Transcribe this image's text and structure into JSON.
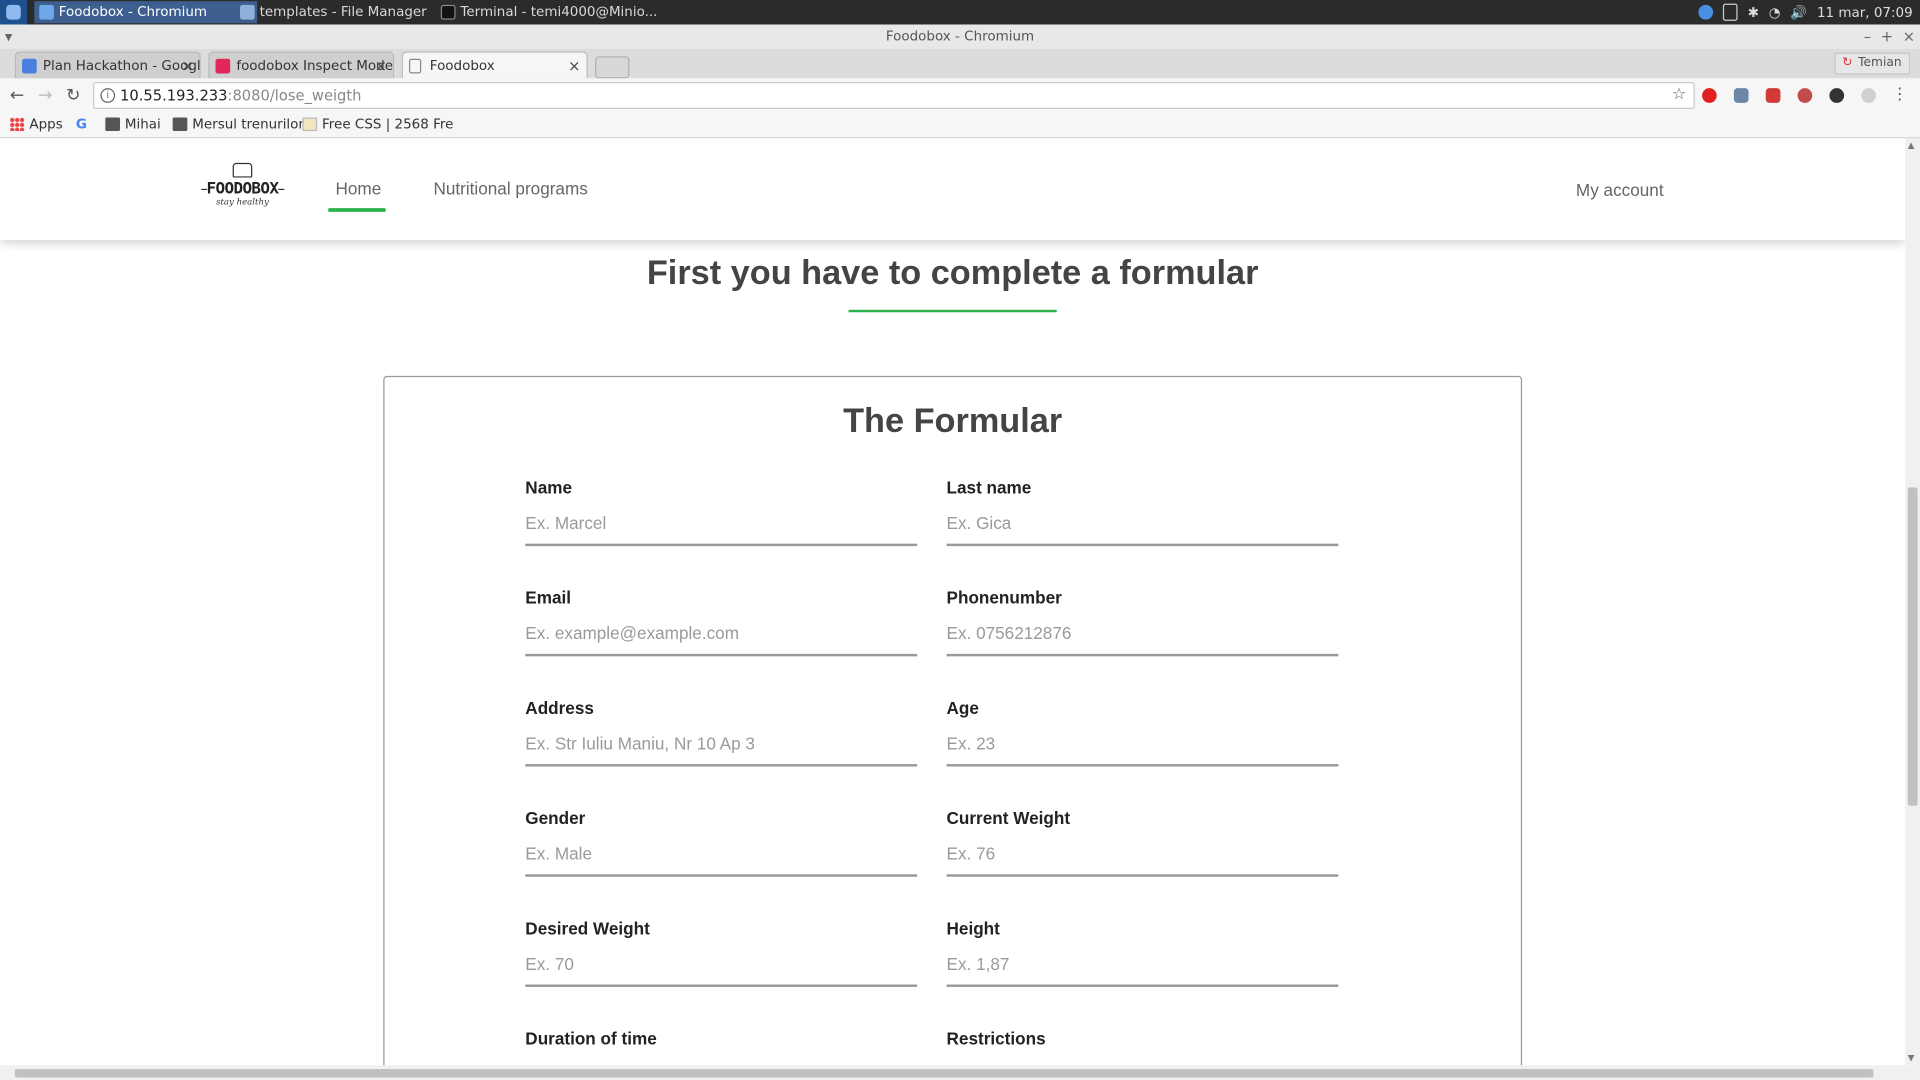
{
  "os": {
    "tasks": [
      {
        "label": "Foodobox - Chromium",
        "active": true
      },
      {
        "label": "templates - File Manager",
        "active": false
      },
      {
        "label": "Terminal - temi4000@Minio...",
        "active": false
      }
    ],
    "clock": "11 mar, 07:09"
  },
  "window": {
    "title": "Foodobox - Chromium",
    "tabs": [
      {
        "label": "Plan Hackathon - Googl",
        "icon_color": "#4a7fe0",
        "icon": "document-icon"
      },
      {
        "label": "foodobox Inspect Mode",
        "icon_color": "#e0265a",
        "icon": "invision-icon"
      },
      {
        "label": "Foodobox",
        "icon_color": "#ffffff",
        "icon": "page-icon"
      }
    ],
    "profile": "Temian"
  },
  "toolbar": {
    "url_host": "10.55.193.233",
    "url_path": ":8080/lose_weigth"
  },
  "bookmarks": [
    {
      "label": "Apps",
      "icon": "apps-grid-icon"
    },
    {
      "label": "",
      "icon": "google-icon"
    },
    {
      "label": "Mihai",
      "icon": "folder-icon"
    },
    {
      "label": "Mersul trenurilor",
      "icon": "folder-icon"
    },
    {
      "label": "Free CSS | 2568 Fre",
      "icon": "page-icon"
    }
  ],
  "site": {
    "logo": {
      "brand": "FOODOBOX",
      "tagline": "stay healthy"
    },
    "nav": {
      "home": "Home",
      "programs": "Nutritional programs",
      "account": "My account"
    },
    "accent_color": "#2bb34a"
  },
  "page": {
    "heading": "First you have to complete a formular",
    "form_title": "The Formular",
    "fields": [
      {
        "label": "Name",
        "placeholder": "Ex. Marcel"
      },
      {
        "label": "Last name",
        "placeholder": "Ex. Gica"
      },
      {
        "label": "Email",
        "placeholder": "Ex. example@example.com"
      },
      {
        "label": "Phonenumber",
        "placeholder": "Ex. 0756212876"
      },
      {
        "label": "Address",
        "placeholder": "Ex. Str Iuliu Maniu, Nr 10 Ap 3"
      },
      {
        "label": "Age",
        "placeholder": "Ex. 23"
      },
      {
        "label": "Gender",
        "placeholder": "Ex. Male"
      },
      {
        "label": "Current Weight",
        "placeholder": "Ex. 76"
      },
      {
        "label": "Desired Weight",
        "placeholder": "Ex. 70"
      },
      {
        "label": "Height",
        "placeholder": "Ex. 1,87"
      },
      {
        "label": "Duration of time",
        "placeholder": ""
      },
      {
        "label": "Restrictions",
        "placeholder": ""
      }
    ]
  }
}
